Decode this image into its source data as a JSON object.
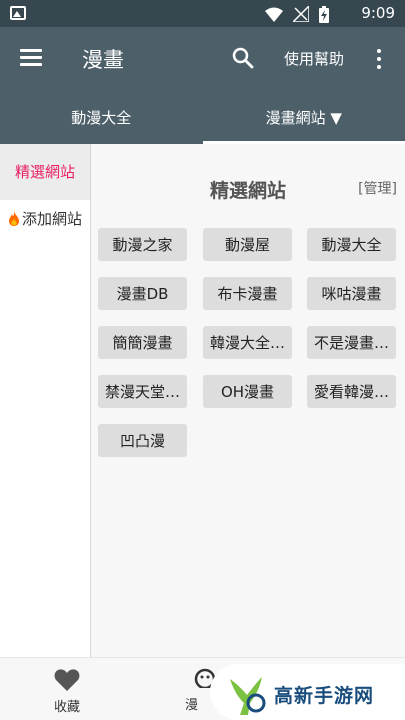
{
  "status_bar": {
    "time": "9:09"
  },
  "app_bar": {
    "title": "漫畫",
    "help": "使用幫助"
  },
  "tabs": [
    {
      "label": "動漫大全"
    },
    {
      "label": "漫畫網站 ▼"
    }
  ],
  "sidebar": {
    "items": [
      {
        "label": "精選網站"
      },
      {
        "label": "添加網站"
      }
    ]
  },
  "content": {
    "section_title": "精選網站",
    "manage": "[管理]",
    "sites": [
      "動漫之家",
      "動漫屋",
      "動漫大全",
      "漫畫DB",
      "布卡漫畫",
      "咪咕漫畫",
      "簡簡漫畫",
      "韓漫大全…",
      "不是漫畫…",
      "禁漫天堂…",
      "OH漫畫",
      "愛看韓漫…",
      "凹凸漫"
    ]
  },
  "bottom_nav": {
    "favorites": "收藏",
    "comics": "漫"
  },
  "watermark": {
    "text": "高新手游网"
  },
  "colors": {
    "app_bar": "#4d606a",
    "status_bar": "#37474f",
    "accent": "#e91e63",
    "chip_bg": "#dddddd"
  }
}
